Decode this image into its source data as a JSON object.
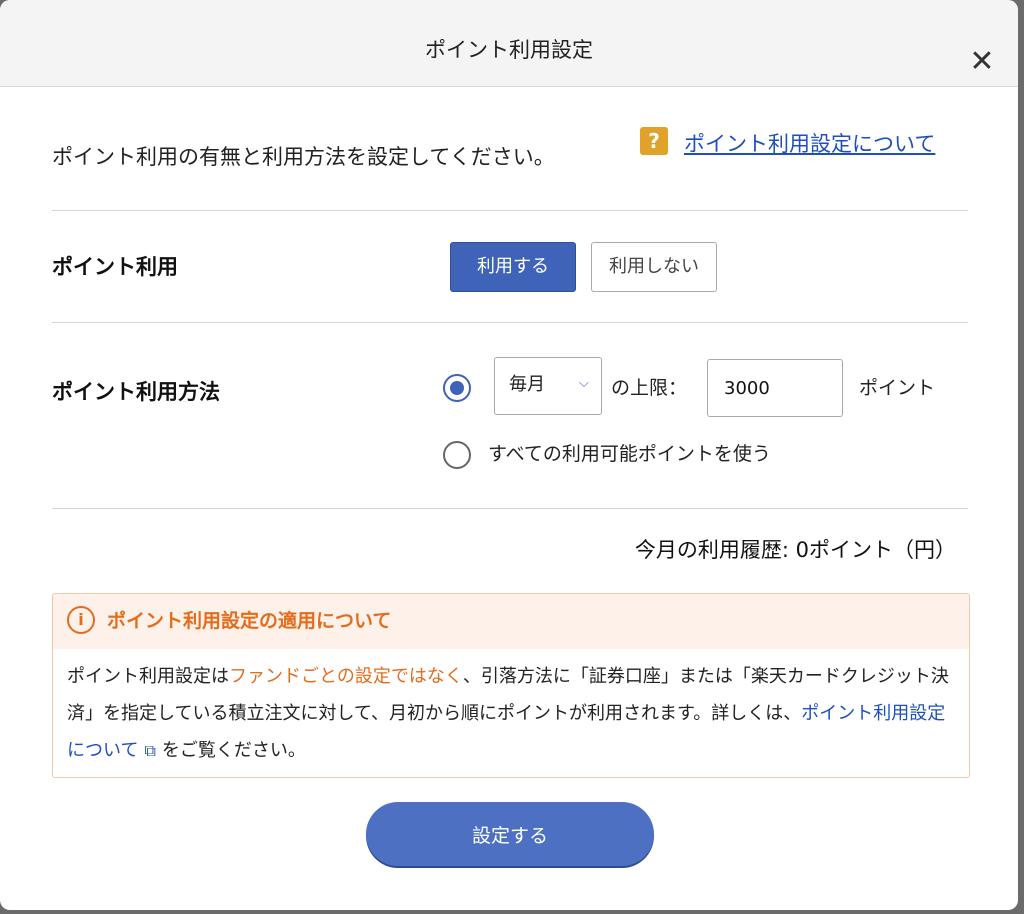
{
  "modal": {
    "title": "ポイント利用設定",
    "close_label": "✕"
  },
  "intro": {
    "text": "ポイント利用の有無と利用方法を設定してください。",
    "help_icon": "?",
    "help_link": "ポイント利用設定について"
  },
  "point_usage": {
    "label": "ポイント利用",
    "option_on": "利用する",
    "option_off": "利用しない",
    "selected": "利用する"
  },
  "usage_method": {
    "label": "ポイント利用方法",
    "period_select_value": "毎月",
    "limit_label": "の上限：",
    "limit_value": "3000",
    "unit": "ポイント",
    "all_points_label": "すべての利用可能ポイントを使う",
    "selected_option": "limit"
  },
  "history": {
    "text": "今月の利用履歴: 0ポイント（円）"
  },
  "notice": {
    "icon": "i",
    "title": "ポイント利用設定の適用について",
    "body_part1": "ポイント利用設定は",
    "body_highlight": "ファンドごとの設定ではなく",
    "body_part2": "、引落方法に「証券口座」または「楽天カードクレジット決済」を指定している積立注文に対して、月初から順にポイントが利用されます。詳しくは、",
    "body_link": "ポイント利用設定について",
    "body_part3": "をご覧ください。"
  },
  "submit": {
    "label": "設定する"
  },
  "icons": {
    "close": "close-icon",
    "help": "question-icon",
    "info": "info-icon",
    "external": "external-link-icon",
    "chevron": "chevron-down-icon"
  },
  "colors": {
    "primary": "#3f63b8",
    "link": "#1f4fbf",
    "notice_accent": "#e46c1d",
    "help_badge": "#e0a22a"
  }
}
